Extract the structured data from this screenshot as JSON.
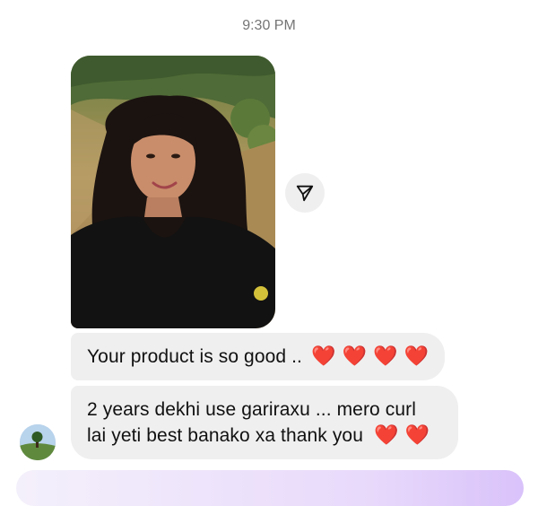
{
  "chat": {
    "timestamp": "9:30 PM",
    "photo": {
      "alt": "Selfie of a woman with curly hair on a hillside"
    },
    "messages": [
      {
        "text": "Your product is so good ..",
        "hearts": "❤️ ❤️ ❤️ ❤️"
      },
      {
        "line1": "2 years dekhi use gariraxu ... mero curl",
        "line2": "lai yeti best banako xa thank you",
        "hearts": "❤️ ❤️"
      }
    ]
  },
  "icons": {
    "share": "paper-plane-icon",
    "avatar": "sender-avatar"
  },
  "colors": {
    "bubble": "#efefef",
    "heart": "#e0191f",
    "timestamp": "#757575",
    "composer_gradient_end": "#d9c2fa"
  }
}
